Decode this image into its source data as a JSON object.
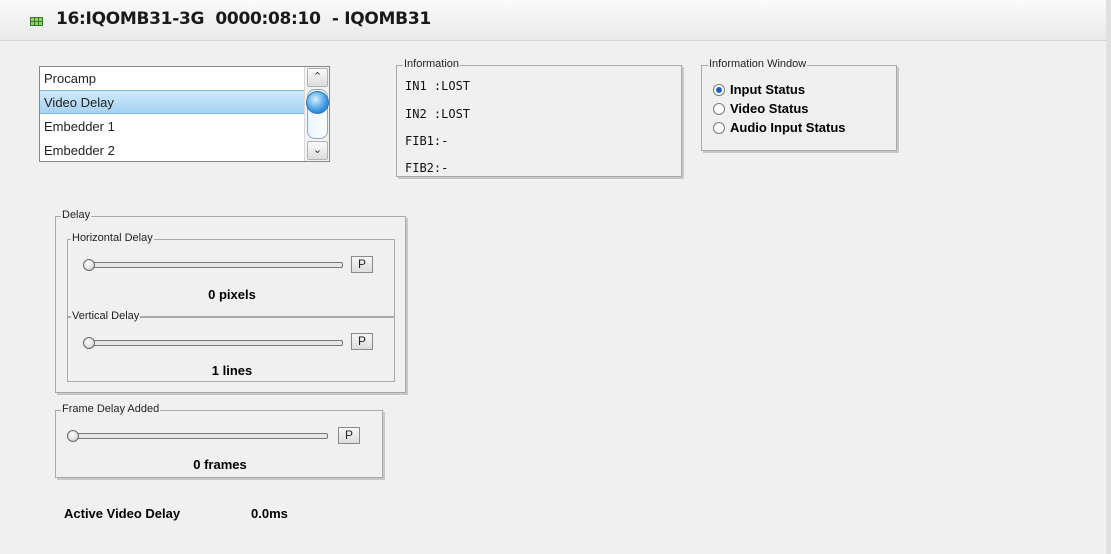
{
  "window": {
    "title": "16:IQOMB31-3G  0000:08:10  - IQOMB31"
  },
  "category_list": {
    "items": [
      "Procamp",
      "Video Delay",
      "Embedder 1",
      "Embedder 2"
    ],
    "selected": "Video Delay"
  },
  "information": {
    "label": "Information",
    "lines": [
      "IN1 :LOST",
      "IN2 :LOST",
      "FIB1:-",
      "FIB2:-"
    ]
  },
  "information_window": {
    "label": "Information Window",
    "options": [
      "Input Status",
      "Video Status",
      "Audio Input Status"
    ],
    "selected": "Input Status"
  },
  "delay": {
    "label": "Delay",
    "horizontal": {
      "label": "Horizontal Delay",
      "value_text": "0 pixels",
      "button_label": "P",
      "value": 0
    },
    "vertical": {
      "label": "Vertical Delay",
      "value_text": "1 lines",
      "button_label": "P",
      "value": 1
    }
  },
  "frame_delay": {
    "label": "Frame Delay Added",
    "value_text": "0 frames",
    "button_label": "P",
    "value": 0
  },
  "active_video_delay": {
    "label": "Active Video Delay",
    "value": "0.0ms"
  },
  "colors": {
    "selection": "#a9d7f5",
    "radio_dot": "#1f5fbf",
    "title_icon": "#2e7d32"
  }
}
